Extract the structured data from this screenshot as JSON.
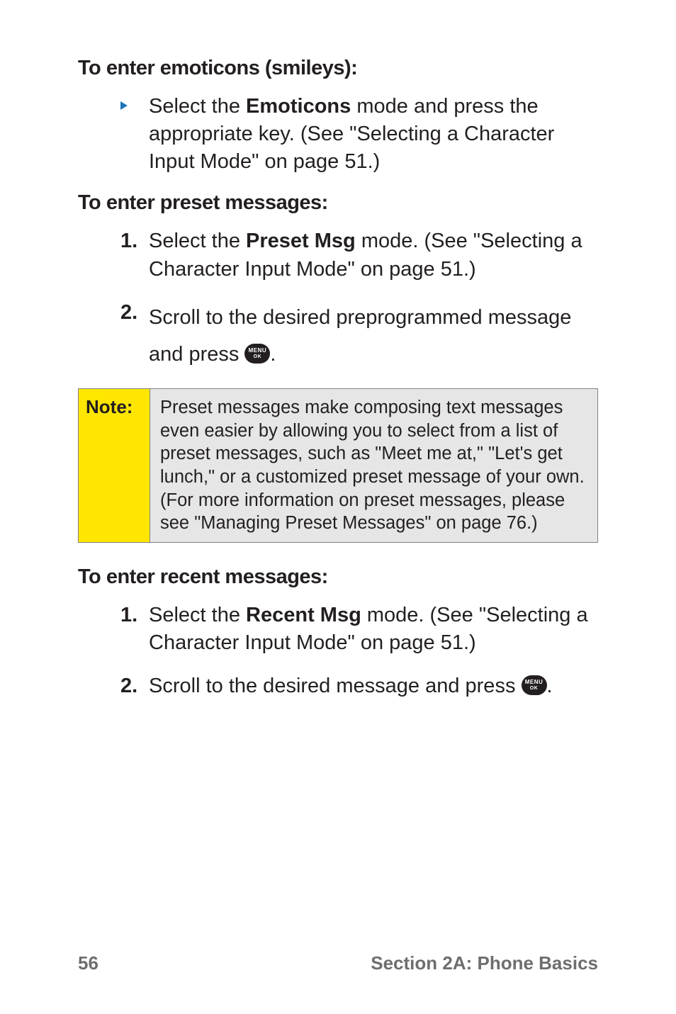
{
  "sections": {
    "emoticons": {
      "heading": "To enter emoticons (smileys):",
      "bullet_before": "Select the ",
      "bullet_bold": "Emoticons",
      "bullet_after": " mode and press the appropriate key. (See \"Selecting a Character Input Mode\" on page 51.)"
    },
    "preset": {
      "heading": "To enter preset messages:",
      "step1_num": "1.",
      "step1_before": "Select the ",
      "step1_bold": "Preset Msg",
      "step1_after": " mode. (See \"Selecting a Character Input Mode\" on page 51.)",
      "step2_num": "2.",
      "step2_before": "Scroll to the desired preprogrammed message and press ",
      "step2_after": "."
    },
    "note": {
      "label": "Note:",
      "body": "Preset messages make composing text messages even easier by allowing you to select from a list of preset messages, such as \"Meet me at,\" \"Let's get lunch,\" or a customized preset message of your own. (For more information on preset messages, please see \"Managing Preset Messages\" on page 76.)"
    },
    "recent": {
      "heading": "To enter recent messages:",
      "step1_num": "1.",
      "step1_before": "Select the ",
      "step1_bold": "Recent Msg",
      "step1_after": " mode. (See \"Selecting a Character Input Mode\" on page 51.)",
      "step2_num": "2.",
      "step2_before": "Scroll to the desired message and press ",
      "step2_after": "."
    }
  },
  "button": {
    "line1": "MENU",
    "line2": "OK"
  },
  "footer": {
    "page_number": "56",
    "section_label": "Section 2A: Phone Basics"
  }
}
